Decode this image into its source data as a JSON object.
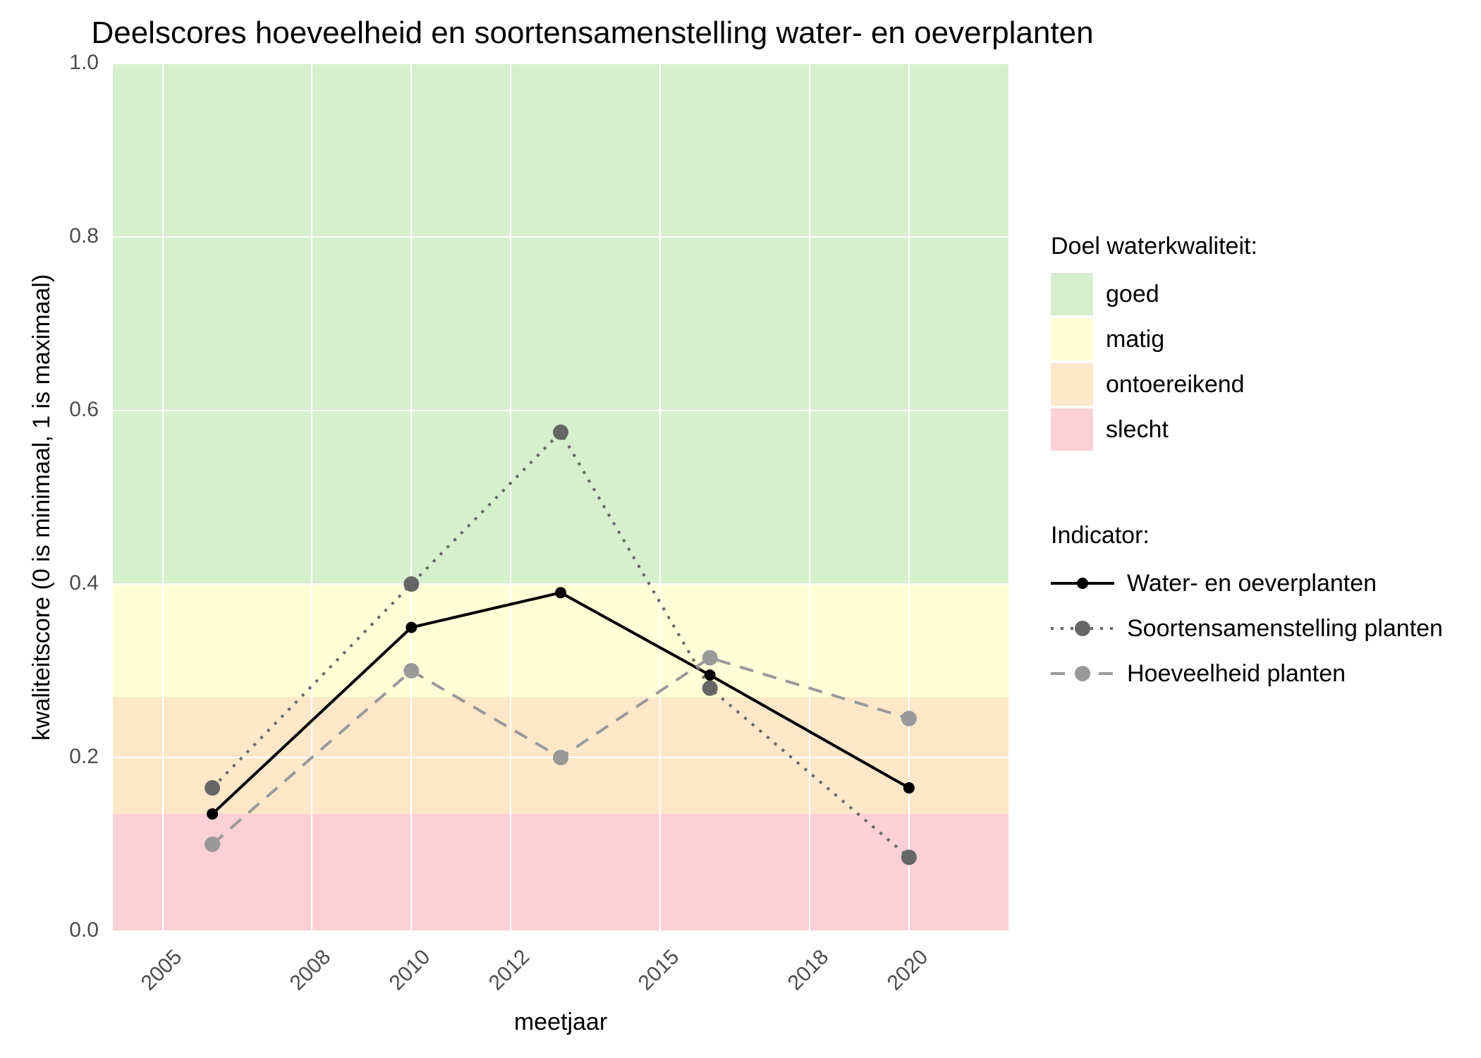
{
  "chart_data": {
    "type": "line",
    "title": "Deelscores hoeveelheid en soortensamenstelling water- en oeverplanten",
    "xlabel": "meetjaar",
    "ylabel": "kwaliteitscore (0 is minimaal, 1 is maximaal)",
    "x_ticks": [
      2005,
      2008,
      2010,
      2012,
      2015,
      2018,
      2020
    ],
    "y_ticks": [
      0.0,
      0.2,
      0.4,
      0.6,
      0.8,
      1.0
    ],
    "xlim": [
      2004,
      2022
    ],
    "ylim": [
      0.0,
      1.0
    ],
    "bands": [
      {
        "name": "goed",
        "from": 0.4,
        "to": 1.0,
        "color": "#d6efce"
      },
      {
        "name": "matig",
        "from": 0.27,
        "to": 0.4,
        "color": "#feffd7"
      },
      {
        "name": "ontoereikend",
        "from": 0.135,
        "to": 0.27,
        "color": "#ffe7c9"
      },
      {
        "name": "slecht",
        "from": 0.0,
        "to": 0.135,
        "color": "#fbd0d7"
      }
    ],
    "x": [
      2006,
      2010,
      2013,
      2016,
      2020
    ],
    "series": [
      {
        "name": "Water- en oeverplanten",
        "key": "water",
        "color": "#000000",
        "dash": "solid",
        "values": [
          0.135,
          0.35,
          0.39,
          0.295,
          0.165
        ]
      },
      {
        "name": "Soortensamenstelling planten",
        "key": "soorten",
        "color": "#666666",
        "dash": "dotted",
        "values": [
          0.165,
          0.4,
          0.575,
          0.28,
          0.085
        ]
      },
      {
        "name": "Hoeveelheid planten",
        "key": "hoeveel",
        "color": "#999999",
        "dash": "dashed",
        "values": [
          0.1,
          0.3,
          0.2,
          0.315,
          0.245
        ]
      }
    ],
    "legend1_title": "Doel waterkwaliteit:",
    "legend2_title": "Indicator:"
  }
}
